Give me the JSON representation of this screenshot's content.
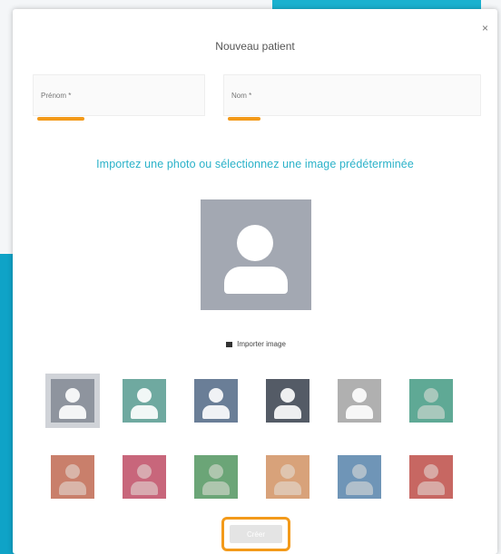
{
  "modal": {
    "title": "Nouveau patient",
    "close_icon": "×"
  },
  "fields": {
    "first_name": {
      "placeholder": "Prénom *",
      "value": ""
    },
    "last_name": {
      "placeholder": "Nom *",
      "value": ""
    }
  },
  "instruction": "Importez une photo ou sélectionnez une image prédéterminée",
  "import_button": {
    "label": "Importer image",
    "icon": "image-icon"
  },
  "avatars": {
    "tiles": [
      {
        "id": "avatar-1",
        "color": "#8e949e",
        "selected": true
      },
      {
        "id": "avatar-2",
        "color": "#6fa9a0",
        "selected": false
      },
      {
        "id": "avatar-3",
        "color": "#6a7e97",
        "selected": false
      },
      {
        "id": "avatar-4",
        "color": "#545b66",
        "selected": false
      },
      {
        "id": "avatar-5",
        "color": "#b0b0b0",
        "selected": false
      },
      {
        "id": "avatar-6",
        "color": "#5fa995",
        "selected": false
      },
      {
        "id": "avatar-7",
        "color": "#c97f6b",
        "selected": false
      },
      {
        "id": "avatar-8",
        "color": "#c8667b",
        "selected": false
      },
      {
        "id": "avatar-9",
        "color": "#6ba577",
        "selected": false
      },
      {
        "id": "avatar-10",
        "color": "#d8a27a",
        "selected": false
      },
      {
        "id": "avatar-11",
        "color": "#6f95b7",
        "selected": false
      },
      {
        "id": "avatar-12",
        "color": "#c76762",
        "selected": false
      }
    ]
  },
  "submit": {
    "label": "Créer"
  },
  "colors": {
    "accent": "#f39a1a",
    "teal": "#2bb2c9",
    "background": "#1aa6c8"
  }
}
